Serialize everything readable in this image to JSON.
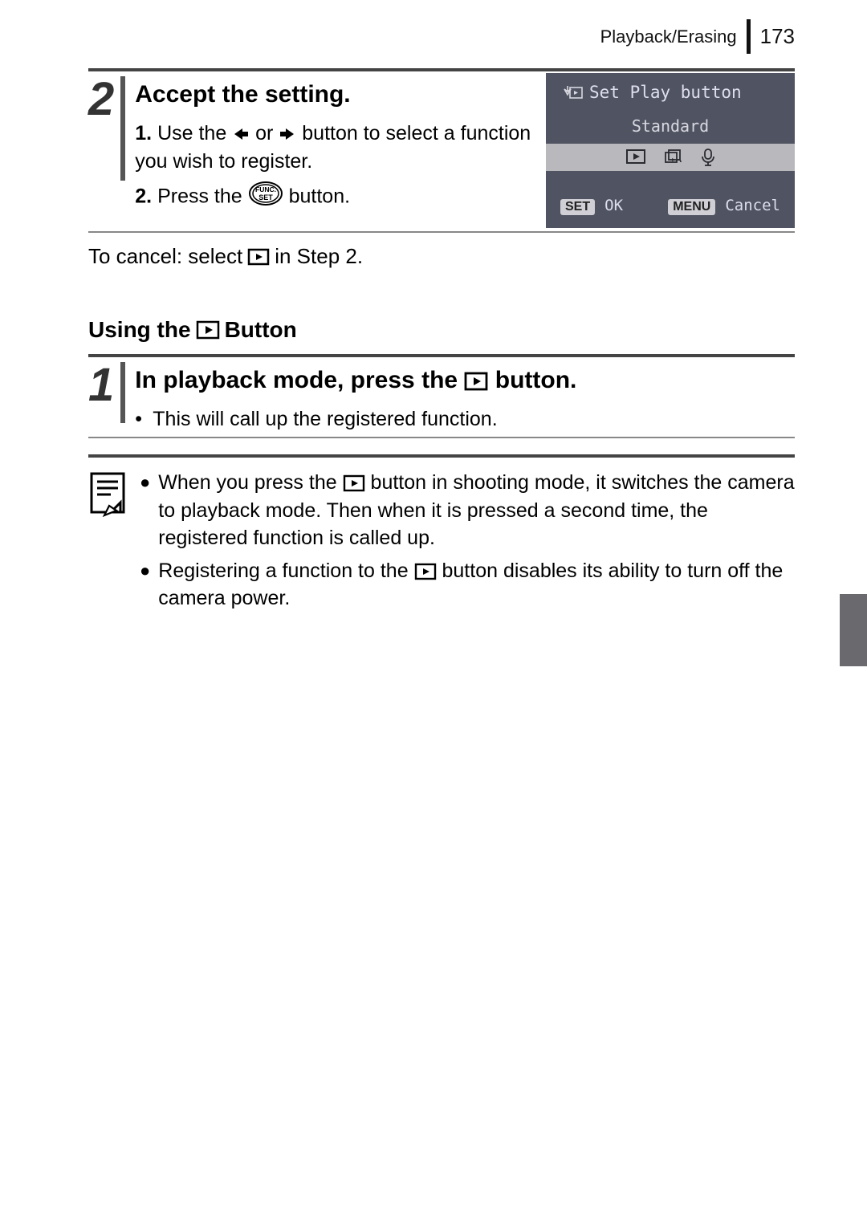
{
  "header": {
    "section": "Playback/Erasing",
    "page": "173"
  },
  "step2": {
    "num": "2",
    "title": "Accept the setting.",
    "sub1_num": "1.",
    "sub1_a": "Use the ",
    "sub1_b": " or ",
    "sub1_c": " button to select a function you wish to register.",
    "sub2_num": "2.",
    "sub2_a": "Press the ",
    "sub2_b": " button."
  },
  "lcd": {
    "title": "Set Play button",
    "mid": "Standard",
    "ok_pill": "SET",
    "ok_text": "OK",
    "cancel_pill": "MENU",
    "cancel_text": "Cancel"
  },
  "cancel": {
    "a": "To cancel: select ",
    "b": " in Step 2."
  },
  "section_heading_a": "Using the ",
  "section_heading_b": " Button",
  "step1": {
    "num": "1",
    "title_a": "In playback mode, press the ",
    "title_b": " button.",
    "bullet": "This will call up the registered function."
  },
  "notes": {
    "n1_a": "When you press the ",
    "n1_b": " button in shooting mode, it switches the camera to playback mode. Then when it is pressed a second time, the registered function is called up.",
    "n2_a": "Registering a function to the ",
    "n2_b": " button disables its ability to turn off the camera power."
  }
}
